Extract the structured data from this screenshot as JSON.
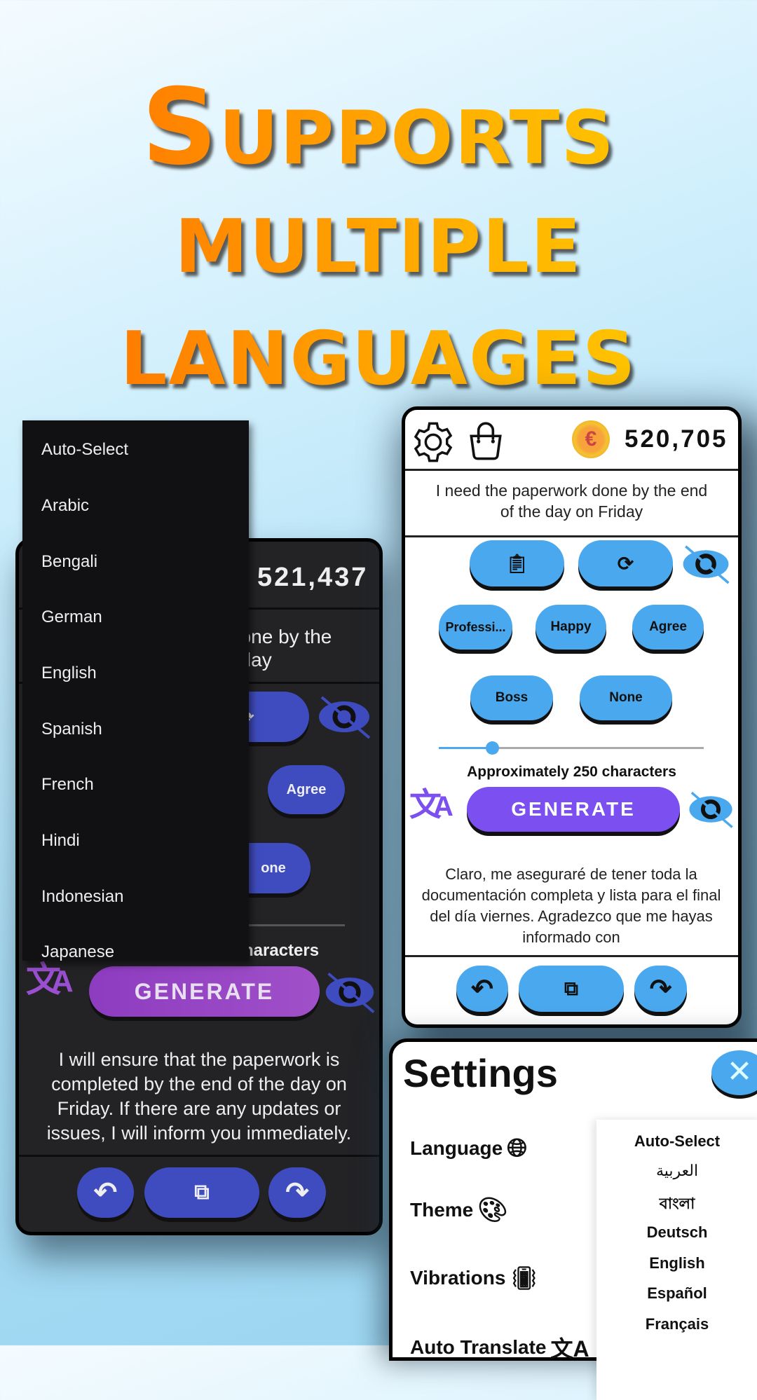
{
  "headline": {
    "line1": "Supports",
    "line2": "multiple",
    "line3": "languages",
    "colors": [
      "#ff6a00",
      "#ffd000"
    ]
  },
  "light_app": {
    "coins": "520,705",
    "prompt": "I need the paperwork done by the end of the day on Friday",
    "tone_chips": [
      "Professi...",
      "Happy",
      "Agree"
    ],
    "recipient_chips": [
      "Boss",
      "None"
    ],
    "length_slider_percent": 20,
    "length_label": "Approximately 250 characters",
    "generate": "GENERATE",
    "result": "Claro, me aseguraré de tener toda la documentación completa y lista para el final del día viernes. Agradezco que me hayas informado con",
    "accent": "#4aa8ef",
    "generate_color": "#7b4ff0"
  },
  "dark_app": {
    "coins": "521,437",
    "prompt_fragment_1": "done by the",
    "prompt_fragment_2": "riday",
    "chip_agree": "Agree",
    "chip_none_fragment": "one",
    "length_fragment": "haracters",
    "generate": "GENERATE",
    "result": "I will ensure that the paperwork is completed by the end of the day on Friday. If there are any updates or issues, I will inform you immediately.",
    "accent": "#3f4cc0"
  },
  "language_dropdown": [
    "Auto-Select",
    "Arabic",
    "Bengali",
    "German",
    "English",
    "Spanish",
    "French",
    "Hindi",
    "Indonesian",
    "Japanese"
  ],
  "settings": {
    "title": "Settings",
    "items": [
      "Language",
      "Theme",
      "Vibrations",
      "Auto Translate"
    ],
    "languages": [
      "Auto-Select",
      "العربية",
      "বাংলা",
      "Deutsch",
      "English",
      "Español",
      "Français"
    ]
  }
}
